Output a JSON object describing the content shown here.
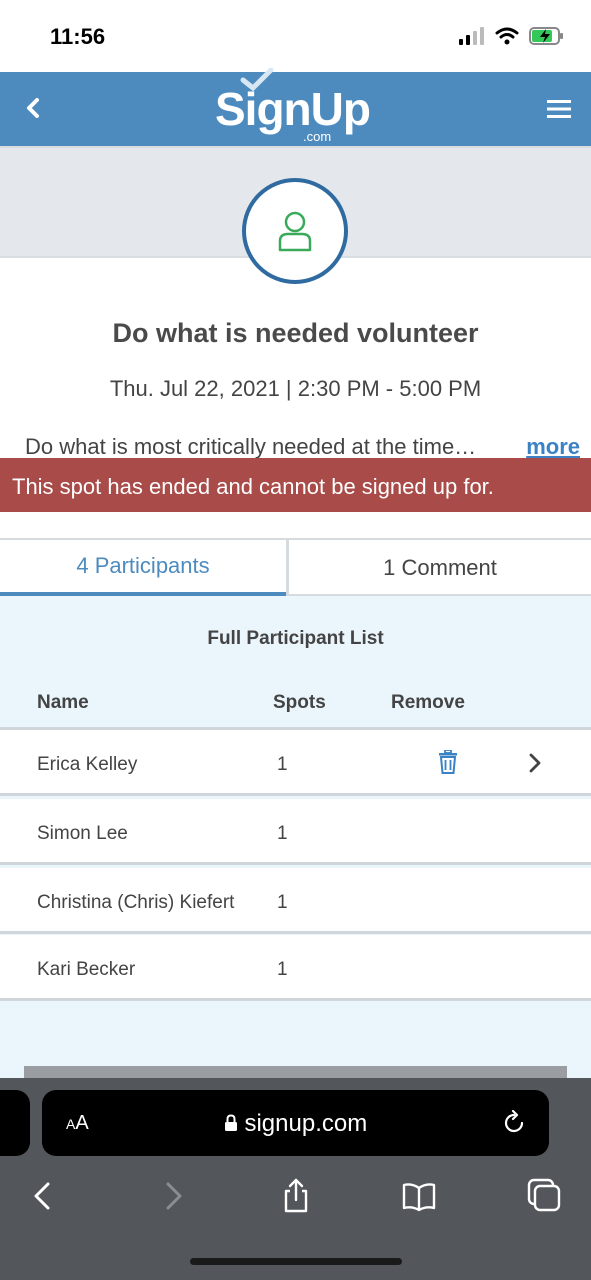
{
  "status_bar": {
    "time": "11:56"
  },
  "header": {
    "logo_main": "SignUp",
    "logo_sub": ".com"
  },
  "event": {
    "title": "Do what is needed volunteer",
    "datetime": "Thu. Jul 22, 2021 | 2:30 PM - 5:00 PM",
    "description": "Do what is most critically needed at the time…",
    "more_label": "more"
  },
  "alert": {
    "message": "This spot has ended and cannot be signed up for."
  },
  "tabs": [
    {
      "label": "4 Participants",
      "active": true
    },
    {
      "label": "1 Comment",
      "active": false
    }
  ],
  "participants": {
    "title": "Full Participant List",
    "columns": {
      "name": "Name",
      "spots": "Spots",
      "remove": "Remove"
    },
    "rows": [
      {
        "name": "Erica Kelley",
        "spots": "1"
      },
      {
        "name": "Simon Lee",
        "spots": "1"
      },
      {
        "name": "Christina (Chris) Kiefert",
        "spots": "1"
      },
      {
        "name": "Kari Becker",
        "spots": "1"
      }
    ]
  },
  "browser": {
    "aa_small": "A",
    "aa_large": "A",
    "url": "signup.com"
  },
  "colors": {
    "brand_blue": "#4d8bbf",
    "alert_red": "#a84b49",
    "avatar_green": "#3aaa5a"
  }
}
